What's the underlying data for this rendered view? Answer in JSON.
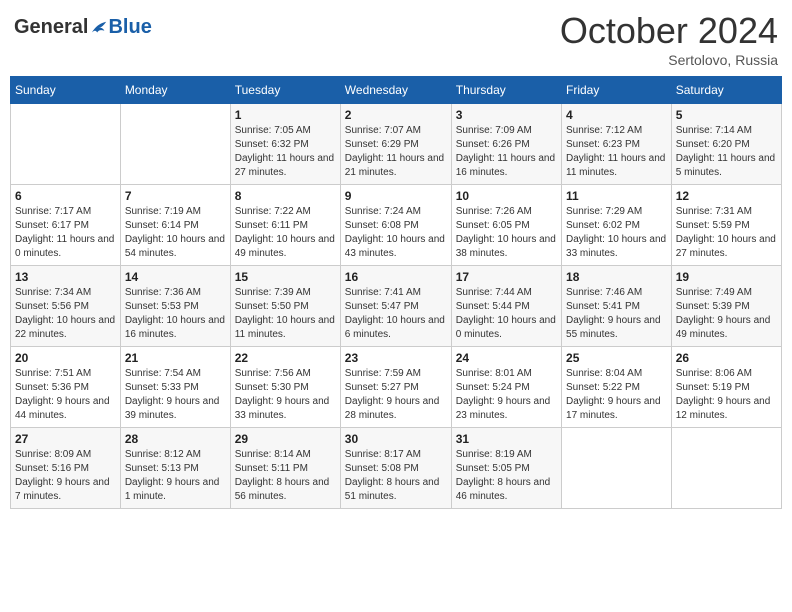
{
  "header": {
    "logo_general": "General",
    "logo_blue": "Blue",
    "month_year": "October 2024",
    "location": "Sertolovo, Russia"
  },
  "days_of_week": [
    "Sunday",
    "Monday",
    "Tuesday",
    "Wednesday",
    "Thursday",
    "Friday",
    "Saturday"
  ],
  "weeks": [
    [
      {
        "num": "",
        "sunrise": "",
        "sunset": "",
        "daylight": ""
      },
      {
        "num": "",
        "sunrise": "",
        "sunset": "",
        "daylight": ""
      },
      {
        "num": "1",
        "sunrise": "Sunrise: 7:05 AM",
        "sunset": "Sunset: 6:32 PM",
        "daylight": "Daylight: 11 hours and 27 minutes."
      },
      {
        "num": "2",
        "sunrise": "Sunrise: 7:07 AM",
        "sunset": "Sunset: 6:29 PM",
        "daylight": "Daylight: 11 hours and 21 minutes."
      },
      {
        "num": "3",
        "sunrise": "Sunrise: 7:09 AM",
        "sunset": "Sunset: 6:26 PM",
        "daylight": "Daylight: 11 hours and 16 minutes."
      },
      {
        "num": "4",
        "sunrise": "Sunrise: 7:12 AM",
        "sunset": "Sunset: 6:23 PM",
        "daylight": "Daylight: 11 hours and 11 minutes."
      },
      {
        "num": "5",
        "sunrise": "Sunrise: 7:14 AM",
        "sunset": "Sunset: 6:20 PM",
        "daylight": "Daylight: 11 hours and 5 minutes."
      }
    ],
    [
      {
        "num": "6",
        "sunrise": "Sunrise: 7:17 AM",
        "sunset": "Sunset: 6:17 PM",
        "daylight": "Daylight: 11 hours and 0 minutes."
      },
      {
        "num": "7",
        "sunrise": "Sunrise: 7:19 AM",
        "sunset": "Sunset: 6:14 PM",
        "daylight": "Daylight: 10 hours and 54 minutes."
      },
      {
        "num": "8",
        "sunrise": "Sunrise: 7:22 AM",
        "sunset": "Sunset: 6:11 PM",
        "daylight": "Daylight: 10 hours and 49 minutes."
      },
      {
        "num": "9",
        "sunrise": "Sunrise: 7:24 AM",
        "sunset": "Sunset: 6:08 PM",
        "daylight": "Daylight: 10 hours and 43 minutes."
      },
      {
        "num": "10",
        "sunrise": "Sunrise: 7:26 AM",
        "sunset": "Sunset: 6:05 PM",
        "daylight": "Daylight: 10 hours and 38 minutes."
      },
      {
        "num": "11",
        "sunrise": "Sunrise: 7:29 AM",
        "sunset": "Sunset: 6:02 PM",
        "daylight": "Daylight: 10 hours and 33 minutes."
      },
      {
        "num": "12",
        "sunrise": "Sunrise: 7:31 AM",
        "sunset": "Sunset: 5:59 PM",
        "daylight": "Daylight: 10 hours and 27 minutes."
      }
    ],
    [
      {
        "num": "13",
        "sunrise": "Sunrise: 7:34 AM",
        "sunset": "Sunset: 5:56 PM",
        "daylight": "Daylight: 10 hours and 22 minutes."
      },
      {
        "num": "14",
        "sunrise": "Sunrise: 7:36 AM",
        "sunset": "Sunset: 5:53 PM",
        "daylight": "Daylight: 10 hours and 16 minutes."
      },
      {
        "num": "15",
        "sunrise": "Sunrise: 7:39 AM",
        "sunset": "Sunset: 5:50 PM",
        "daylight": "Daylight: 10 hours and 11 minutes."
      },
      {
        "num": "16",
        "sunrise": "Sunrise: 7:41 AM",
        "sunset": "Sunset: 5:47 PM",
        "daylight": "Daylight: 10 hours and 6 minutes."
      },
      {
        "num": "17",
        "sunrise": "Sunrise: 7:44 AM",
        "sunset": "Sunset: 5:44 PM",
        "daylight": "Daylight: 10 hours and 0 minutes."
      },
      {
        "num": "18",
        "sunrise": "Sunrise: 7:46 AM",
        "sunset": "Sunset: 5:41 PM",
        "daylight": "Daylight: 9 hours and 55 minutes."
      },
      {
        "num": "19",
        "sunrise": "Sunrise: 7:49 AM",
        "sunset": "Sunset: 5:39 PM",
        "daylight": "Daylight: 9 hours and 49 minutes."
      }
    ],
    [
      {
        "num": "20",
        "sunrise": "Sunrise: 7:51 AM",
        "sunset": "Sunset: 5:36 PM",
        "daylight": "Daylight: 9 hours and 44 minutes."
      },
      {
        "num": "21",
        "sunrise": "Sunrise: 7:54 AM",
        "sunset": "Sunset: 5:33 PM",
        "daylight": "Daylight: 9 hours and 39 minutes."
      },
      {
        "num": "22",
        "sunrise": "Sunrise: 7:56 AM",
        "sunset": "Sunset: 5:30 PM",
        "daylight": "Daylight: 9 hours and 33 minutes."
      },
      {
        "num": "23",
        "sunrise": "Sunrise: 7:59 AM",
        "sunset": "Sunset: 5:27 PM",
        "daylight": "Daylight: 9 hours and 28 minutes."
      },
      {
        "num": "24",
        "sunrise": "Sunrise: 8:01 AM",
        "sunset": "Sunset: 5:24 PM",
        "daylight": "Daylight: 9 hours and 23 minutes."
      },
      {
        "num": "25",
        "sunrise": "Sunrise: 8:04 AM",
        "sunset": "Sunset: 5:22 PM",
        "daylight": "Daylight: 9 hours and 17 minutes."
      },
      {
        "num": "26",
        "sunrise": "Sunrise: 8:06 AM",
        "sunset": "Sunset: 5:19 PM",
        "daylight": "Daylight: 9 hours and 12 minutes."
      }
    ],
    [
      {
        "num": "27",
        "sunrise": "Sunrise: 8:09 AM",
        "sunset": "Sunset: 5:16 PM",
        "daylight": "Daylight: 9 hours and 7 minutes."
      },
      {
        "num": "28",
        "sunrise": "Sunrise: 8:12 AM",
        "sunset": "Sunset: 5:13 PM",
        "daylight": "Daylight: 9 hours and 1 minute."
      },
      {
        "num": "29",
        "sunrise": "Sunrise: 8:14 AM",
        "sunset": "Sunset: 5:11 PM",
        "daylight": "Daylight: 8 hours and 56 minutes."
      },
      {
        "num": "30",
        "sunrise": "Sunrise: 8:17 AM",
        "sunset": "Sunset: 5:08 PM",
        "daylight": "Daylight: 8 hours and 51 minutes."
      },
      {
        "num": "31",
        "sunrise": "Sunrise: 8:19 AM",
        "sunset": "Sunset: 5:05 PM",
        "daylight": "Daylight: 8 hours and 46 minutes."
      },
      {
        "num": "",
        "sunrise": "",
        "sunset": "",
        "daylight": ""
      },
      {
        "num": "",
        "sunrise": "",
        "sunset": "",
        "daylight": ""
      }
    ]
  ]
}
